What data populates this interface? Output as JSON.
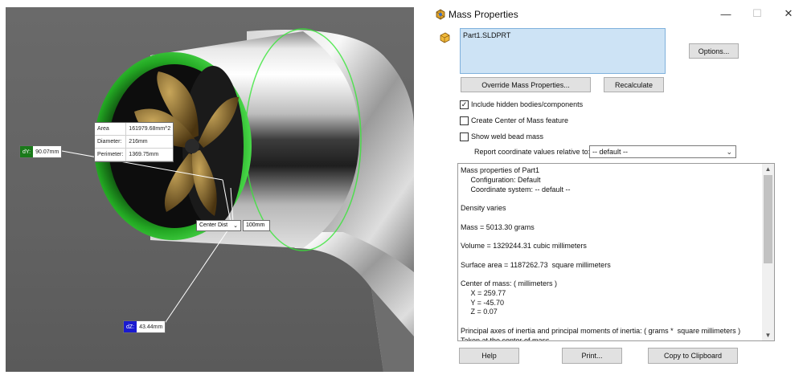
{
  "viewport": {
    "area_callout": {
      "rows": [
        {
          "label": "Area",
          "value": "161979.68mm^2"
        },
        {
          "label": "Diameter:",
          "value": "216mm"
        },
        {
          "label": "Perimeter:",
          "value": "1369.75mm"
        }
      ]
    },
    "dy_tag": {
      "badge": "dY:",
      "value": "90.07mm"
    },
    "dz_tag": {
      "badge": "dZ:",
      "value": "43.44mm"
    },
    "center_dist": {
      "selected": "Center Dist",
      "value": "100mm"
    },
    "colors": {
      "highlight": "#2fd12f",
      "dy_badge": "#1a7a1a",
      "dz_badge": "#1a1ad0"
    }
  },
  "dialog": {
    "title": "Mass Properties",
    "part_name": "Part1.SLDPRT",
    "options_label": "Options...",
    "override_label": "Override Mass Properties...",
    "recalculate_label": "Recalculate",
    "checkboxes": [
      {
        "label": "Include hidden bodies/components",
        "checked": true
      },
      {
        "label": "Create Center of Mass feature",
        "checked": false
      },
      {
        "label": "Show weld bead mass",
        "checked": false
      }
    ],
    "report_label": "Report coordinate values relative to:",
    "report_value": "-- default --",
    "results": [
      "Mass properties of Part1",
      "     Configuration: Default",
      "     Coordinate system: -- default --",
      "",
      "Density varies",
      "",
      "Mass = 5013.30 grams",
      "",
      "Volume = 1329244.31 cubic millimeters",
      "",
      "Surface area = 1187262.73  square millimeters",
      "",
      "Center of mass: ( millimeters )",
      "     X = 259.77",
      "     Y = -45.70",
      "     Z = 0.07",
      "",
      "Principal axes of inertia and principal moments of inertia: ( grams *  square millimeters )",
      "Taken at the center of mass."
    ],
    "help_label": "Help",
    "print_label": "Print...",
    "copy_label": "Copy to Clipboard",
    "minimize_icon": "—",
    "maximize_icon": "☐",
    "close_icon": "✕"
  }
}
